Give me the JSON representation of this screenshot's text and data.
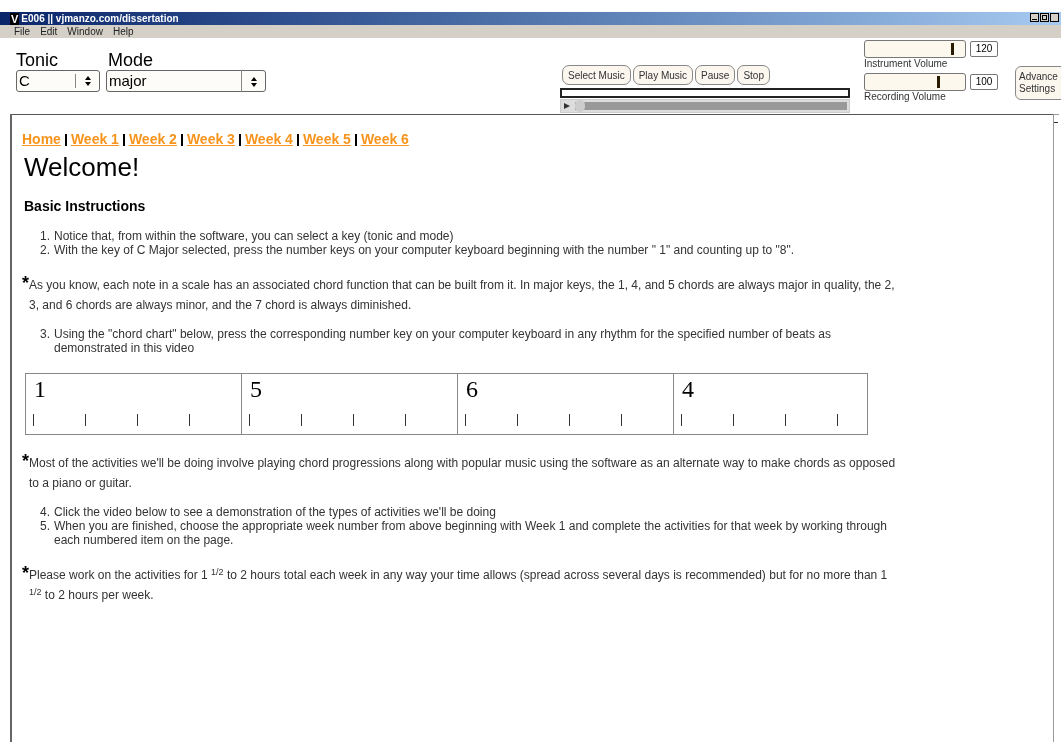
{
  "window": {
    "logo": "V",
    "title": "E006 || vjmanzo.com/dissertation"
  },
  "menu": [
    "File",
    "Edit",
    "Window",
    "Help"
  ],
  "key": {
    "tonic": {
      "label": "Tonic",
      "value": "C"
    },
    "mode": {
      "label": "Mode",
      "value": "major"
    }
  },
  "player": {
    "buttons": [
      "Select Music",
      "Play Music",
      "Pause",
      "Stop"
    ],
    "position": {
      "level": 0
    }
  },
  "volumes": [
    {
      "label": "Instrument Volume",
      "level": 0.9,
      "value": "120"
    },
    {
      "label": "Recording Volume",
      "level": 0.75,
      "value": "100"
    }
  ],
  "advanced_button": [
    "Advance",
    "Settings"
  ],
  "nav_links": [
    "Home",
    "Week 1",
    "Week 2",
    "Week 3",
    "Week 4",
    "Week 5",
    "Week 6"
  ],
  "heading": "Welcome!",
  "subheading": "Basic Instructions",
  "blocks": [
    {
      "kind": "list",
      "items": [
        {
          "number": "1.",
          "text": "Notice that, from within the software, you can select a key (tonic and mode)"
        },
        {
          "number": "2.",
          "text": "With the key of C Major selected, press the number keys on your computer keyboard beginning with the number \" 1\" and counting up to \"8\"."
        }
      ]
    },
    {
      "kind": "note",
      "marker": "*",
      "text": "As you know, each note in a scale has an associated chord function that can be built from it. In major keys, the 1, 4, and 5 chords are always major in quality, the 2, 3, and 6 chords are always minor, and the 7 chord is always diminished."
    },
    {
      "kind": "list",
      "items": [
        {
          "number": "3.",
          "text": "Using the \"chord chart\" below, press the corresponding number key on your computer keyboard in any rhythm for the specified number of beats as demonstrated in this video"
        }
      ]
    },
    {
      "kind": "chart",
      "measures": [
        "1",
        "5",
        "6",
        "4"
      ]
    },
    {
      "kind": "note",
      "marker": "*",
      "text": "Most of the activities we'll be doing involve playing chord progressions along with popular music using the software as an alternate way to make chords as opposed to a piano or guitar."
    },
    {
      "kind": "list",
      "items": [
        {
          "number": "4.",
          "text": "Click the video below to see a demonstration of the types of activities we'll be doing"
        },
        {
          "number": "5.",
          "text": "When you are finished, choose the appropriate week number from above beginning with Week 1 and complete the activities for that week by working through each numbered item on the page."
        }
      ]
    },
    {
      "kind": "note",
      "marker": "*",
      "text": "Please work on the activities for 1 $^{1/2}$ to 2 hours total each week in any way your time allows (spread across several days is recommended) but for no more than 1 $^{1/2}$ to 2 hours per week."
    }
  ]
}
